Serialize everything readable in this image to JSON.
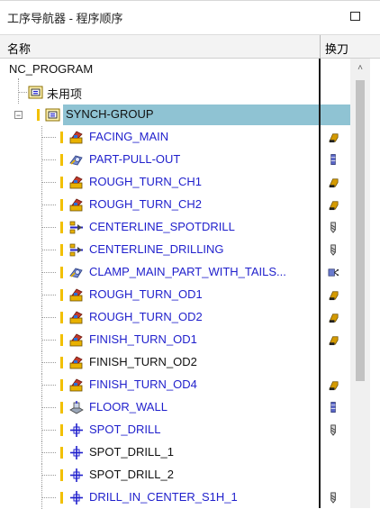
{
  "title": "工序导航器 - 程序顺序",
  "header": {
    "name": "名称",
    "tool": "换刀"
  },
  "root": "NC_PROGRAM",
  "unused_label": "未用项",
  "group_label": "SYNCH-GROUP",
  "rows": [
    {
      "name": "FACING_MAIN",
      "color": "blue",
      "op_icon": "turning-op-icon",
      "tool_icon": "turn-tool-icon"
    },
    {
      "name": "PART-PULL-OUT",
      "color": "blue",
      "op_icon": "part-handling-icon",
      "tool_icon": "bar-tool-icon"
    },
    {
      "name": "ROUGH_TURN_CH1",
      "color": "blue",
      "op_icon": "turning-op-icon",
      "tool_icon": "turn-tool-icon"
    },
    {
      "name": "ROUGH_TURN_CH2",
      "color": "blue",
      "op_icon": "turning-op-icon",
      "tool_icon": "turn-tool-icon"
    },
    {
      "name": "CENTERLINE_SPOTDRILL",
      "color": "blue",
      "op_icon": "centerline-drill-icon",
      "tool_icon": "drill-tool-icon"
    },
    {
      "name": "CENTERLINE_DRILLING",
      "color": "blue",
      "op_icon": "centerline-drill-icon",
      "tool_icon": "drill-tool-icon"
    },
    {
      "name": "CLAMP_MAIN_PART_WITH_TAILS...",
      "color": "blue",
      "op_icon": "part-handling-icon",
      "tool_icon": "tailstock-tool-icon"
    },
    {
      "name": "ROUGH_TURN_OD1",
      "color": "blue",
      "op_icon": "turning-op-icon",
      "tool_icon": "turn-tool-icon"
    },
    {
      "name": "ROUGH_TURN_OD2",
      "color": "blue",
      "op_icon": "turning-op-icon",
      "tool_icon": "turn-tool-icon"
    },
    {
      "name": "FINISH_TURN_OD1",
      "color": "blue",
      "op_icon": "turning-op-icon",
      "tool_icon": "turn-tool-icon"
    },
    {
      "name": "FINISH_TURN_OD2",
      "color": "black",
      "op_icon": "turning-op-icon",
      "tool_icon": ""
    },
    {
      "name": "FINISH_TURN_OD4",
      "color": "blue",
      "op_icon": "turning-op-icon",
      "tool_icon": "turn-tool-icon"
    },
    {
      "name": "FLOOR_WALL",
      "color": "blue",
      "op_icon": "floor-wall-icon",
      "tool_icon": "bar-tool-icon"
    },
    {
      "name": "SPOT_DRILL",
      "color": "blue",
      "op_icon": "spot-drill-icon",
      "tool_icon": "drill-tool-icon"
    },
    {
      "name": "SPOT_DRILL_1",
      "color": "black",
      "op_icon": "spot-drill-icon",
      "tool_icon": ""
    },
    {
      "name": "SPOT_DRILL_2",
      "color": "black",
      "op_icon": "spot-drill-icon",
      "tool_icon": ""
    },
    {
      "name": "DRILL_IN_CENTER_S1H_1",
      "color": "blue",
      "op_icon": "spot-drill-icon",
      "tool_icon": "drill-tool-icon"
    }
  ],
  "colors": {
    "selection": "#8fc3d3",
    "op_text": "#1f1fcc",
    "status_bar": "#f2c000"
  }
}
